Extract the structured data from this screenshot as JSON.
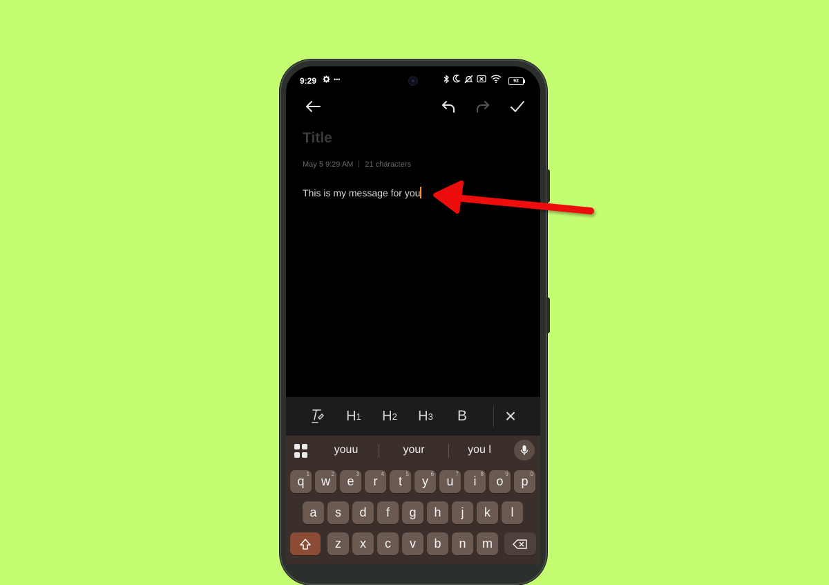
{
  "status_bar": {
    "time": "9:29",
    "settings_icon": "gear-icon",
    "more": "•••",
    "battery": "92",
    "icons": [
      "bluetooth-icon",
      "moon-icon",
      "bell-off-icon",
      "x-box-icon",
      "wifi-icon"
    ]
  },
  "toolbar": {
    "back": "back-arrow-icon",
    "undo": "undo-icon",
    "redo": "redo-icon",
    "done": "check-icon"
  },
  "note": {
    "title_placeholder": "Title",
    "date": "May 5 9:29 AM",
    "characters": "21 characters",
    "body": "This is my message for you"
  },
  "format_bar": {
    "style_icon": "text-style-icon",
    "h1": "H",
    "h1_sub": "1",
    "h2": "H",
    "h2_sub": "2",
    "h3": "H",
    "h3_sub": "3",
    "bold": "B",
    "close": "×"
  },
  "keyboard": {
    "suggestions": [
      "youu",
      "your",
      "you l"
    ],
    "row1": [
      "q",
      "w",
      "e",
      "r",
      "t",
      "y",
      "u",
      "i",
      "o",
      "p"
    ],
    "row1_hints": [
      "1",
      "2",
      "3",
      "4",
      "5",
      "6",
      "7",
      "8",
      "9",
      "0"
    ],
    "row2": [
      "a",
      "s",
      "d",
      "f",
      "g",
      "h",
      "j",
      "k",
      "l"
    ],
    "row3": [
      "z",
      "x",
      "c",
      "v",
      "b",
      "n",
      "m"
    ]
  },
  "colors": {
    "background": "#c4fd72",
    "annotation_arrow": "#ee1111",
    "caret": "#ff8c2a",
    "keyboard_bg": "#3a2f2a"
  }
}
